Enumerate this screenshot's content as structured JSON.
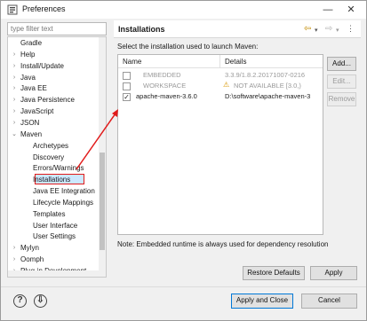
{
  "window": {
    "title": "Preferences"
  },
  "filter": {
    "placeholder": "type filter text"
  },
  "tree": [
    {
      "label": "Gradle",
      "twisty": "",
      "indent": 0
    },
    {
      "label": "Help",
      "twisty": "›",
      "indent": 0
    },
    {
      "label": "Install/Update",
      "twisty": "›",
      "indent": 0
    },
    {
      "label": "Java",
      "twisty": "›",
      "indent": 0
    },
    {
      "label": "Java EE",
      "twisty": "›",
      "indent": 0
    },
    {
      "label": "Java Persistence",
      "twisty": "›",
      "indent": 0
    },
    {
      "label": "JavaScript",
      "twisty": "›",
      "indent": 0
    },
    {
      "label": "JSON",
      "twisty": "›",
      "indent": 0
    },
    {
      "label": "Maven",
      "twisty": "⌄",
      "indent": 0
    },
    {
      "label": "Archetypes",
      "twisty": "",
      "indent": 1
    },
    {
      "label": "Discovery",
      "twisty": "",
      "indent": 1
    },
    {
      "label": "Errors/Warnings",
      "twisty": "",
      "indent": 1
    },
    {
      "label": "Installations",
      "twisty": "",
      "indent": 1,
      "selected": true
    },
    {
      "label": "Java EE Integration",
      "twisty": "",
      "indent": 1
    },
    {
      "label": "Lifecycle Mappings",
      "twisty": "",
      "indent": 1
    },
    {
      "label": "Templates",
      "twisty": "",
      "indent": 1
    },
    {
      "label": "User Interface",
      "twisty": "",
      "indent": 1
    },
    {
      "label": "User Settings",
      "twisty": "",
      "indent": 1
    },
    {
      "label": "Mylyn",
      "twisty": "›",
      "indent": 0
    },
    {
      "label": "Oomph",
      "twisty": "›",
      "indent": 0
    },
    {
      "label": "Plug-in Development",
      "twisty": "›",
      "indent": 0
    }
  ],
  "panel": {
    "title": "Installations",
    "description": "Select the installation used to launch Maven:",
    "columns": {
      "name": "Name",
      "details": "Details"
    },
    "rows": [
      {
        "checked": false,
        "name": "EMBEDDED",
        "details": "3.3.9/1.8.2.20171007-0216",
        "grey": true,
        "warn": false
      },
      {
        "checked": false,
        "name": "WORKSPACE",
        "details": "NOT AVAILABLE [3.0,)",
        "grey": true,
        "warn": true
      },
      {
        "checked": true,
        "name": "apache-maven-3.6.0",
        "details": "D:\\software\\apache-maven-3",
        "grey": false,
        "warn": false
      }
    ],
    "buttons": {
      "add": "Add...",
      "edit": "Edit...",
      "remove": "Remove"
    },
    "note": "Note: Embedded runtime is always used for dependency resolution",
    "restore_defaults": "Restore Defaults",
    "apply": "Apply"
  },
  "footer": {
    "help_icon": "?",
    "import_icon": "⇩",
    "apply_and_close": "Apply and Close",
    "cancel": "Cancel"
  },
  "colors": {
    "annotation": "#e11b1b",
    "selection": "#cce8ff",
    "focus": "#0078d7"
  }
}
